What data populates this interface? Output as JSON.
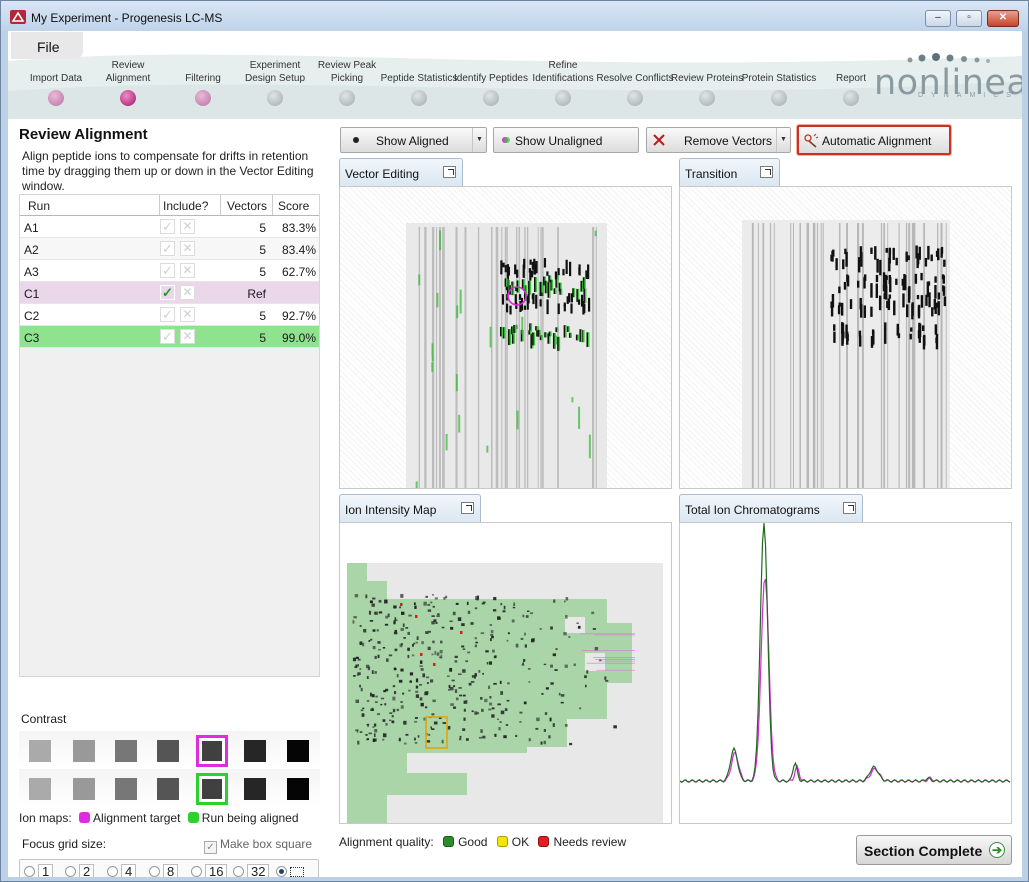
{
  "window": {
    "title": "My Experiment - Progenesis LC-MS",
    "minimize": "–",
    "maximize": "▫",
    "close": "✕"
  },
  "menu": {
    "file": "File"
  },
  "workflow": {
    "steps": [
      {
        "label": "Import Data",
        "state": "done"
      },
      {
        "label": "Review Alignment",
        "state": "active"
      },
      {
        "label": "Filtering",
        "state": "done"
      },
      {
        "label": "Experiment Design Setup",
        "state": "todo"
      },
      {
        "label": "Review Peak Picking",
        "state": "todo"
      },
      {
        "label": "Peptide Statistics",
        "state": "todo"
      },
      {
        "label": "Identify Peptides",
        "state": "todo"
      },
      {
        "label": "Refine Identifications",
        "state": "todo"
      },
      {
        "label": "Resolve Conflicts",
        "state": "todo"
      },
      {
        "label": "Review Proteins",
        "state": "todo"
      },
      {
        "label": "Protein Statistics",
        "state": "todo"
      },
      {
        "label": "Report",
        "state": "todo"
      }
    ]
  },
  "logo": {
    "word": "nonlinear",
    "sub": "DYNAMICS"
  },
  "left": {
    "title": "Review Alignment",
    "description": "Align peptide ions to compensate for drifts in retention time by dragging them up or down in the Vector Editing window.",
    "table": {
      "headers": {
        "run": "Run",
        "include": "Include?",
        "vectors": "Vectors",
        "score": "Score"
      },
      "rows": [
        {
          "run": "A1",
          "vectors": "5",
          "score": "83.3%",
          "style": "plain"
        },
        {
          "run": "A2",
          "vectors": "5",
          "score": "83.4%",
          "style": "alt"
        },
        {
          "run": "A3",
          "vectors": "5",
          "score": "62.7%",
          "style": "plain"
        },
        {
          "run": "C1",
          "vectors": "Ref",
          "score": "",
          "style": "ref"
        },
        {
          "run": "C2",
          "vectors": "5",
          "score": "92.7%",
          "style": "plain"
        },
        {
          "run": "C3",
          "vectors": "5",
          "score": "99.0%",
          "style": "sel"
        }
      ]
    },
    "contrast_label": "Contrast",
    "ion_maps_label": "Ion maps:",
    "alignment_target": "Alignment target",
    "run_being_aligned": "Run being aligned",
    "focus_grid_label": "Focus grid size:",
    "make_box_square": "Make box square",
    "grid_sizes": [
      "1",
      "2",
      "4",
      "8",
      "16",
      "32"
    ],
    "grid_selected": "box"
  },
  "toolbar": {
    "show_aligned": "Show Aligned",
    "show_unaligned": "Show Unaligned",
    "remove_vectors": "Remove Vectors",
    "automatic_alignment": "Automatic Alignment"
  },
  "panes": {
    "vector_editing": "Vector Editing",
    "transition": "Transition",
    "ion_intensity_map": "Ion Intensity Map",
    "total_ion_chromatograms": "Total Ion Chromatograms"
  },
  "quality": {
    "label": "Alignment quality:",
    "good": "Good",
    "ok": "OK",
    "needs_review": "Needs review"
  },
  "colors": {
    "good": "#2a8c2a",
    "ok": "#f2e600",
    "needs_review": "#e02020",
    "target": "#e02ce0",
    "aligned": "#2ad22a",
    "accent": "#c8321e"
  },
  "section_complete": "Section Complete"
}
